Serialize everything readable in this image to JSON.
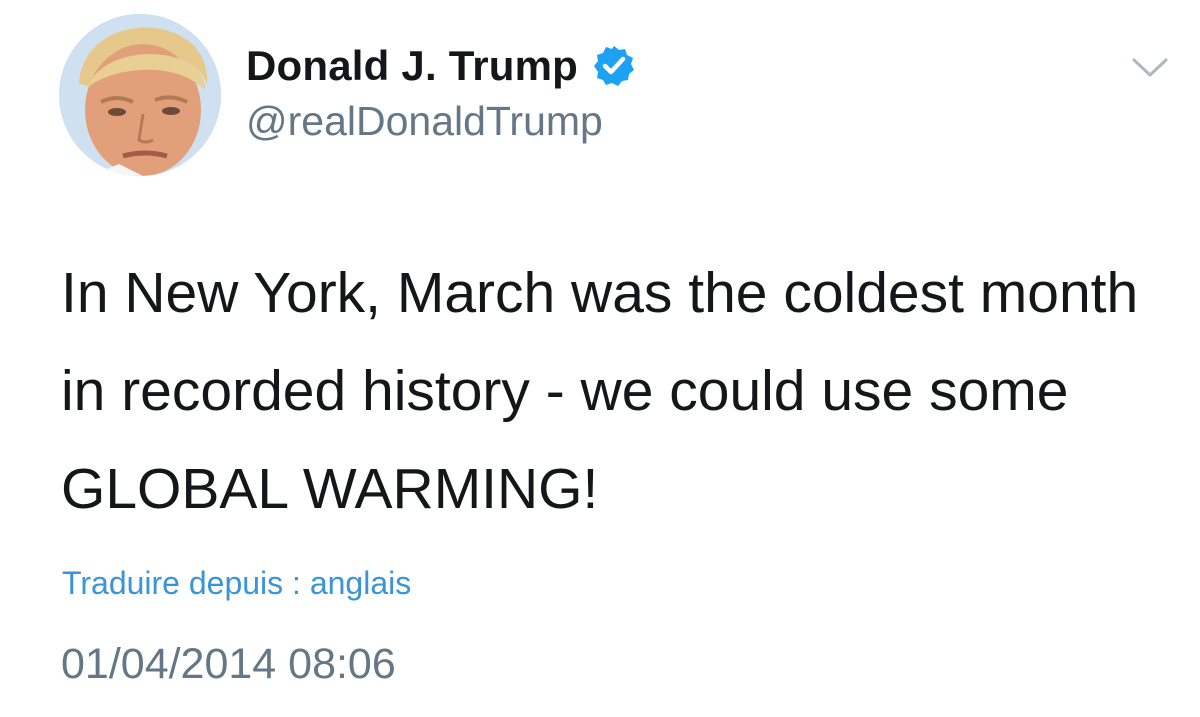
{
  "tweet": {
    "author": {
      "display_name": "Donald J. Trump",
      "handle": "@realDonaldTrump",
      "verified": true,
      "avatar_icon": "profile-photo"
    },
    "text": "In New York, March was the coldest month in recorded history - we could use some GLOBAL WARMING!",
    "translate_label": "Traduire depuis : anglais",
    "timestamp": "01/04/2014 08:06",
    "menu_icon": "chevron-down-icon"
  },
  "colors": {
    "text_primary": "#14171a",
    "text_secondary": "#657786",
    "link": "#3a94d9",
    "verified_badge": "#1da1f2"
  }
}
